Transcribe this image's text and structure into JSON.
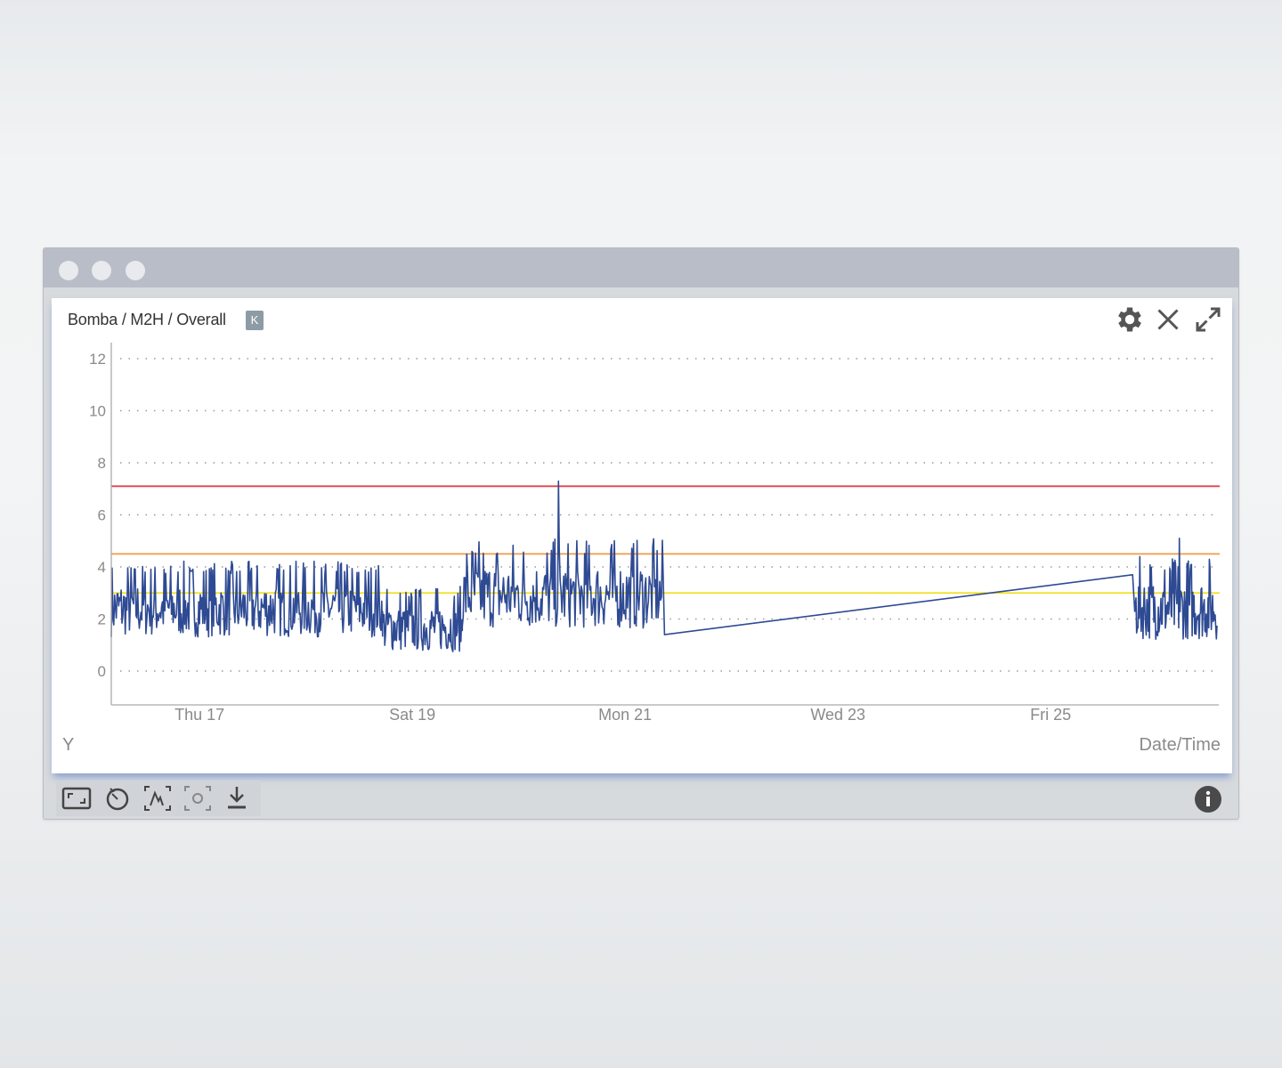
{
  "window": {
    "title_dots": [
      "close-dot",
      "minimize-dot",
      "maximize-dot"
    ]
  },
  "panel": {
    "title": "Bomba / M2H / Overall",
    "badge": "K",
    "controls": [
      "gear-icon",
      "close-icon",
      "expand-icon"
    ]
  },
  "chart": {
    "y_axis_label": "Y",
    "x_axis_label": "Date/Time",
    "y_ticks": [
      "12",
      "10",
      "8",
      "6",
      "4",
      "2",
      "0"
    ],
    "x_ticks": [
      "Thu 17",
      "Sat 19",
      "Mon 21",
      "Wed 23",
      "Fri 25"
    ]
  },
  "chart_data": {
    "type": "line",
    "y_axis_label": "Y",
    "x_axis_label": "Date/Time",
    "ylim": [
      0,
      12
    ],
    "xlim": [
      "2021-06-16 12:00",
      "2021-06-26 03:00"
    ],
    "x_tick_labels": [
      "Thu 17",
      "Sat 19",
      "Mon 21",
      "Wed 23",
      "Fri 25"
    ],
    "grid": "horizontal-dotted",
    "thresholds": [
      {
        "level": "alarm",
        "value": 7.1,
        "color": "#e8404a"
      },
      {
        "level": "alert",
        "value": 4.5,
        "color": "#f39a45"
      },
      {
        "level": "warning",
        "value": 3.0,
        "color": "#f2e020"
      }
    ],
    "series": [
      {
        "color": "#2e4a93",
        "segments": [
          {
            "from": "Thu 16 12:00",
            "to": "Sat 19 00:00",
            "baseline": 2.3,
            "spread": 2.2
          },
          {
            "from": "Sat 19 00:00",
            "to": "Sat 19 18:00",
            "baseline": 1.5,
            "spread": 1.8
          },
          {
            "from": "Sat 19 18:00",
            "to": "Mon 21 06:00",
            "baseline": 2.7,
            "spread": 2.5,
            "peak": 7.3
          },
          {
            "from": "Mon 21 06:00",
            "to": "Fri 25 12:00",
            "gap_line": [
              1.4,
              3.7
            ]
          },
          {
            "from": "Fri 25 12:00",
            "to": "Sat 26 03:00",
            "baseline": 2.3,
            "spread": 2.4,
            "peak": 5.1
          }
        ]
      }
    ]
  },
  "toolbar": {
    "buttons": [
      "fit-view-icon",
      "reset-time-icon",
      "zoom-curve-icon",
      "focus-area-icon",
      "download-icon"
    ]
  },
  "info": {
    "icon": "info-icon"
  }
}
